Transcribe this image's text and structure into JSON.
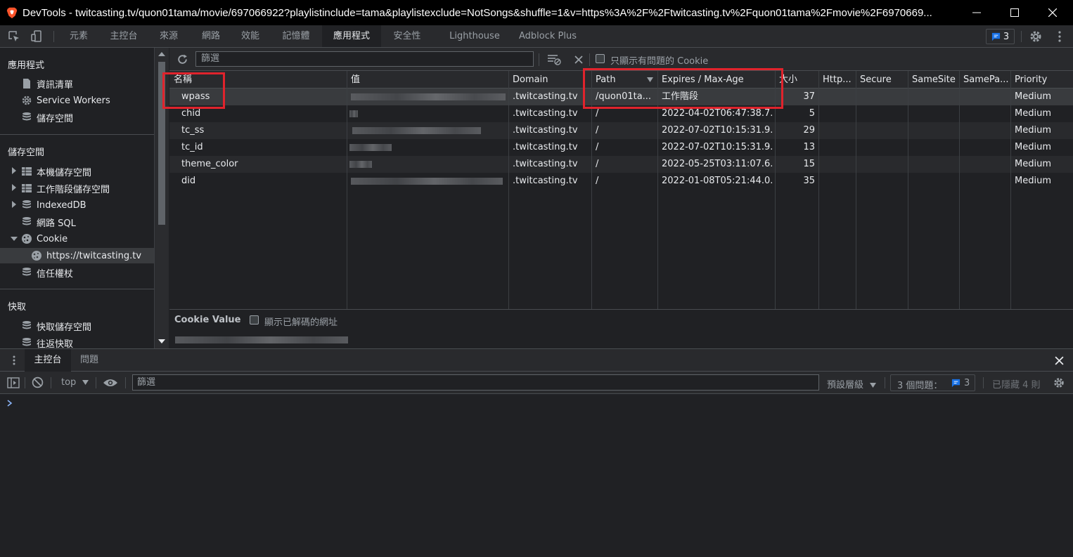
{
  "window": {
    "title": "DevTools - twitcasting.tv/quon01tama/movie/697066922?playlistinclude=tama&playlistexclude=NotSongs&shuffle=1&v=https%3A%2F%2Ftwitcasting.tv%2Fquon01tama%2Fmovie%2F6970669..."
  },
  "tabs": [
    "元素",
    "主控台",
    "來源",
    "網路",
    "效能",
    "記憶體",
    "應用程式",
    "安全性",
    "Lighthouse",
    "Adblock Plus"
  ],
  "active_tab": "應用程式",
  "issues_badge": "3",
  "sidebar": {
    "app_header": "應用程式",
    "app_items": [
      "資訊清單",
      "Service Workers",
      "儲存空間"
    ],
    "storage_header": "儲存空間",
    "storage_items": [
      "本機儲存空間",
      "工作階段儲存空間",
      "IndexedDB",
      "網路 SQL",
      "Cookie",
      "https://twitcasting.tv",
      "信任權杖"
    ],
    "cache_header": "快取",
    "cache_items": [
      "快取儲存空間",
      "往返快取"
    ]
  },
  "cookie_toolbar": {
    "filter_placeholder": "篩選",
    "only_issues_label": "只顯示有問題的 Cookie"
  },
  "cookie_table": {
    "columns": [
      "名稱",
      "值",
      "Domain",
      "Path",
      "Expires / Max-Age",
      "大小",
      "Http...",
      "Secure",
      "SameSite",
      "SamePa...",
      "Priority"
    ],
    "rows": [
      {
        "name": "wpass",
        "domain": ".twitcasting.tv",
        "path": "/quon01ta...",
        "expires": "工作階段",
        "size": "37",
        "priority": "Medium"
      },
      {
        "name": "chid",
        "domain": ".twitcasting.tv",
        "path": "/",
        "expires": "2022-04-02T06:47:38.7...",
        "size": "5",
        "priority": "Medium"
      },
      {
        "name": "tc_ss",
        "domain": ".twitcasting.tv",
        "path": "/",
        "expires": "2022-07-02T10:15:31.9...",
        "size": "29",
        "priority": "Medium"
      },
      {
        "name": "tc_id",
        "domain": ".twitcasting.tv",
        "path": "/",
        "expires": "2022-07-02T10:15:31.9...",
        "size": "13",
        "priority": "Medium"
      },
      {
        "name": "theme_color",
        "domain": ".twitcasting.tv",
        "path": "/",
        "expires": "2022-05-25T03:11:07.6...",
        "size": "15",
        "priority": "Medium"
      },
      {
        "name": "did",
        "domain": ".twitcasting.tv",
        "path": "/",
        "expires": "2022-01-08T05:21:44.0...",
        "size": "35",
        "priority": "Medium"
      }
    ]
  },
  "cookie_value": {
    "label": "Cookie Value",
    "decode_label": "顯示已解碼的網址"
  },
  "drawer": {
    "tabs": [
      "主控台",
      "問題"
    ],
    "context": "top",
    "filter_placeholder": "篩選",
    "levels": "預設層級",
    "issues_text": "3 個問題：",
    "issues_count": "3",
    "hidden_text": "已隱藏 4 則"
  },
  "colors": {
    "highlight_border": "#e0232c",
    "accent_blue": "#8ab4f8",
    "badge_blue": "#1a73e8"
  }
}
